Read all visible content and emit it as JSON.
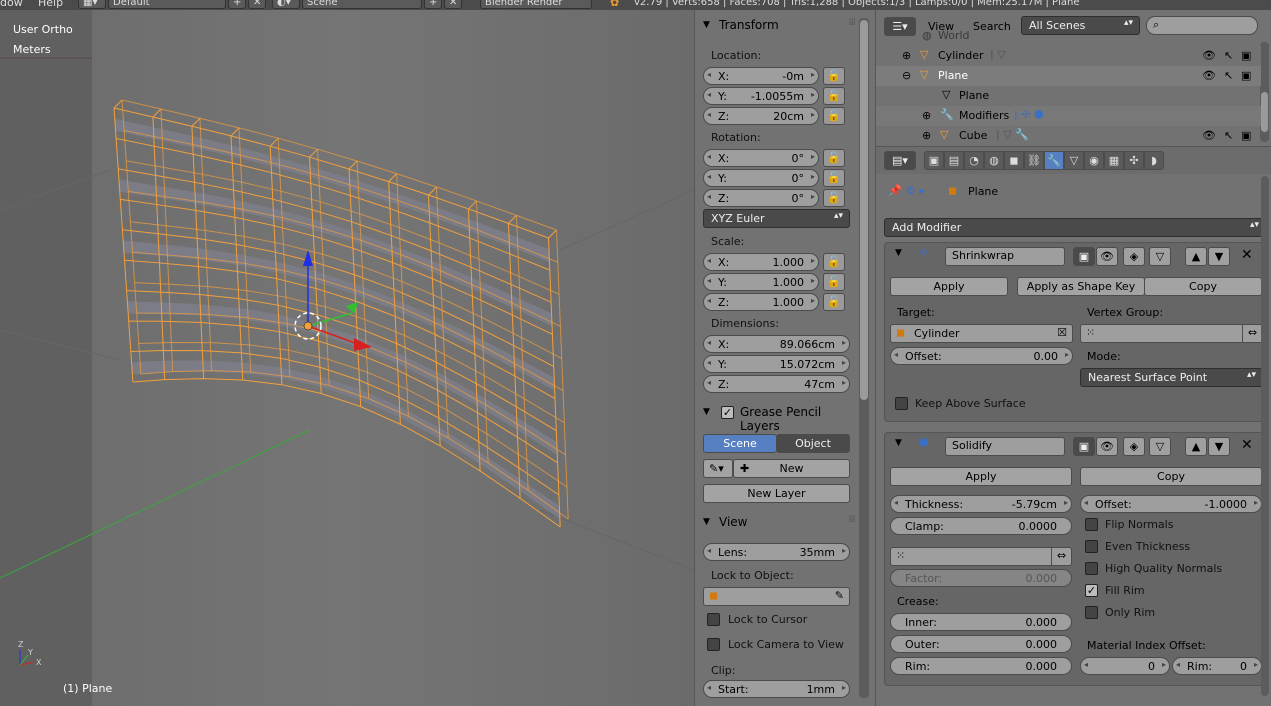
{
  "topbar": {
    "menu_window": "dow",
    "menu_help": "Help",
    "layout": "Default",
    "scene": "Scene",
    "engine": "Blender Render",
    "stats": "v2.79 | Verts:658 | Faces:708 | Tris:1,288 | Objects:1/3 | Lamps:0/0 | Mem:25.17M | Plane"
  },
  "viewport": {
    "view_name": "User Ortho",
    "units": "Meters",
    "object_label": "(1) Plane",
    "axis_labels": {
      "x": "X",
      "y": "Y",
      "z": "Z"
    }
  },
  "npanel": {
    "transform": {
      "title": "Transform",
      "location_label": "Location:",
      "location": [
        {
          "k": "X:",
          "v": "-0m"
        },
        {
          "k": "Y:",
          "v": "-1.0055m"
        },
        {
          "k": "Z:",
          "v": "20cm"
        }
      ],
      "rotation_label": "Rotation:",
      "rotation": [
        {
          "k": "X:",
          "v": "0°"
        },
        {
          "k": "Y:",
          "v": "0°"
        },
        {
          "k": "Z:",
          "v": "0°"
        }
      ],
      "rotation_mode": "XYZ Euler",
      "scale_label": "Scale:",
      "scale": [
        {
          "k": "X:",
          "v": "1.000"
        },
        {
          "k": "Y:",
          "v": "1.000"
        },
        {
          "k": "Z:",
          "v": "1.000"
        }
      ],
      "dimensions_label": "Dimensions:",
      "dimensions": [
        {
          "k": "X:",
          "v": "89.066cm"
        },
        {
          "k": "Y:",
          "v": "15.072cm"
        },
        {
          "k": "Z:",
          "v": "47cm"
        }
      ]
    },
    "grease": {
      "title": "Grease Pencil Layers",
      "tab_scene": "Scene",
      "tab_object": "Object",
      "new": "New",
      "new_layer": "New Layer"
    },
    "view": {
      "title": "View",
      "lens_label": "Lens:",
      "lens_value": "35mm",
      "lock_to_object": "Lock to Object:",
      "lock_to_cursor": "Lock to Cursor",
      "lock_camera": "Lock Camera to View",
      "clip": "Clip:",
      "start_label": "Start:",
      "start_value": "1mm"
    }
  },
  "outliner": {
    "view_menu": "View",
    "search_menu": "Search",
    "filter": "All Scenes",
    "rows": [
      {
        "name": "World"
      },
      {
        "name": "Cylinder"
      },
      {
        "name": "Plane"
      },
      {
        "name": "Plane"
      },
      {
        "name": "Modifiers"
      },
      {
        "name": "Cube"
      }
    ]
  },
  "props": {
    "context_object": "Plane",
    "add_modifier": "Add Modifier",
    "shrinkwrap": {
      "name": "Shrinkwrap",
      "apply": "Apply",
      "apply_shape": "Apply as Shape Key",
      "copy": "Copy",
      "target_label": "Target:",
      "target_value": "Cylinder",
      "vgroup_label": "Vertex Group:",
      "offset_label": "Offset:",
      "offset_value": "0.00",
      "mode_label": "Mode:",
      "mode_value": "Nearest Surface Point",
      "keep_above": "Keep Above Surface"
    },
    "solidify": {
      "name": "Solidify",
      "apply": "Apply",
      "copy": "Copy",
      "thickness_label": "Thickness:",
      "thickness_value": "-5.79cm",
      "offset_label": "Offset:",
      "offset_value": "-1.0000",
      "clamp_label": "Clamp:",
      "clamp_value": "0.0000",
      "flip_normals": "Flip Normals",
      "even_thickness": "Even Thickness",
      "high_quality": "High Quality Normals",
      "fill_rim": "Fill Rim",
      "only_rim": "Only Rim",
      "factor_label": "Factor:",
      "factor_value": "0.000",
      "crease_label": "Crease:",
      "inner_label": "Inner:",
      "inner_value": "0.000",
      "outer_label": "Outer:",
      "outer_value": "0.000",
      "rim_label": "Rim:",
      "rim_value": "0.000",
      "mat_offset_label": "Material Index Offset:",
      "mat_offset_value": "0",
      "mat_rim_label": "Rim:",
      "mat_rim_value": "0"
    }
  },
  "colors": {
    "selection_orange": "#f2a03c",
    "axis_x": "#d92020",
    "axis_y": "#2fbf2f",
    "axis_z": "#2030e0",
    "active_tab": "#5680c2"
  }
}
